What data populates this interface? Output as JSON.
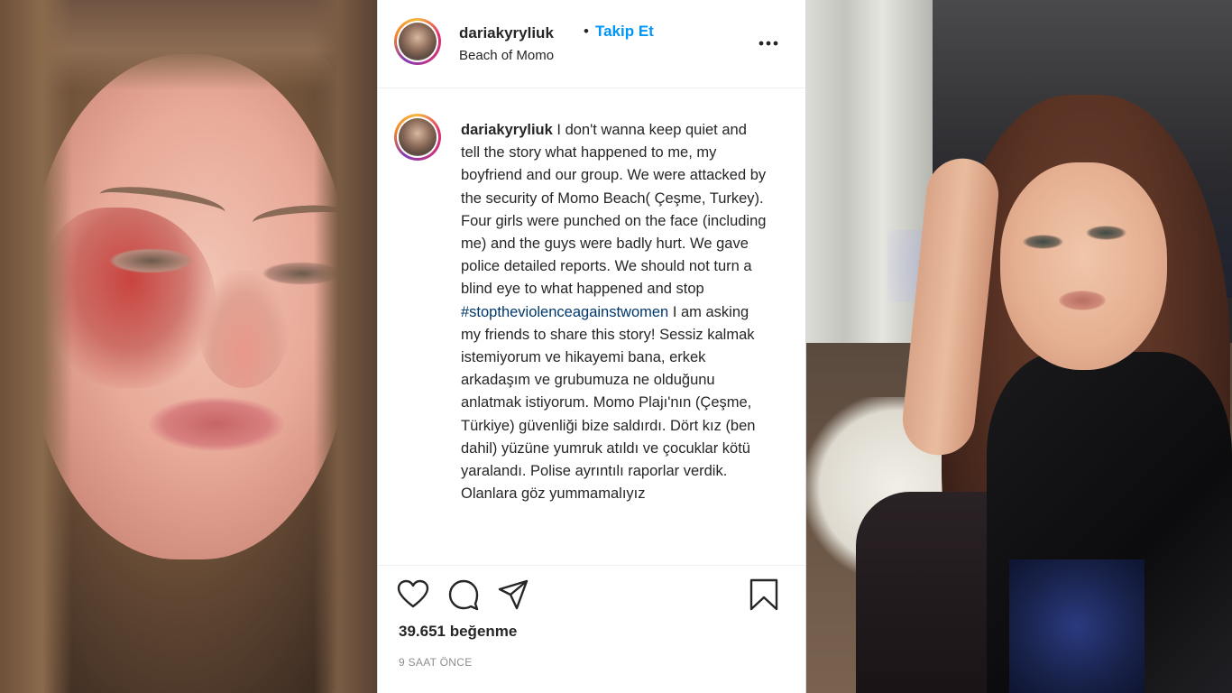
{
  "post": {
    "username": "dariakyryliuk",
    "separator": "•",
    "follow_label": "Takip Et",
    "location": "Beach of Momo",
    "more_icon": "more-options-icon",
    "caption": {
      "username": "dariakyryliuk",
      "text_before_hashtag": " I don't wanna keep quiet and tell the story what happened to me, my boyfriend and our group. We were attacked by the security of Momo Beach( Çeşme, Turkey). Four girls were punched on the face (including me) and the guys were badly hurt. We gave police detailed reports. We should not turn a blind eye to what happened and stop ",
      "hashtag": "#stoptheviolenceagainstwomen",
      "text_after_hashtag": " I am asking my friends to share this story! Sessiz kalmak istemiyorum ve hikayemi bana, erkek arkadaşım ve grubumuza ne olduğunu anlatmak istiyorum. Momo Plajı'nın (Çeşme, Türkiye) güvenliği bize saldırdı. Dört kız (ben dahil) yüzüne yumruk atıldı ve çocuklar kötü yaralandı. Polise ayrıntılı raporlar verdik. Olanlara göz yummamalıyız"
    },
    "actions": {
      "like_icon": "heart-icon",
      "comment_icon": "comment-icon",
      "share_icon": "paper-plane-icon",
      "save_icon": "bookmark-icon"
    },
    "likes": "39.651 beğenme",
    "timestamp": "9 SAAT ÖNCE"
  },
  "colors": {
    "follow_blue": "#0095f6",
    "hashtag_blue": "#00376b",
    "text_dark": "#262626",
    "text_muted": "#8e8e8e",
    "divider": "#efefef"
  }
}
